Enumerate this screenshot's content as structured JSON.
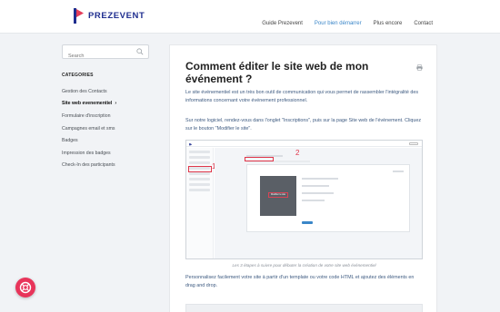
{
  "header": {
    "brand": "PREZEVENT",
    "nav": [
      {
        "label": "Guide Prezevent",
        "active": false
      },
      {
        "label": "Pour bien démarrer",
        "active": true
      },
      {
        "label": "Plus encore",
        "active": false
      },
      {
        "label": "Contact",
        "active": false
      }
    ]
  },
  "sidebar": {
    "search_placeholder": "Search",
    "categories_title": "CATEGORIES",
    "items": [
      {
        "label": "Gestion des Contacts"
      },
      {
        "label": "Site web evenementiel",
        "active": true
      },
      {
        "label": "Formulaire d'inscription"
      },
      {
        "label": "Campagnes email et sms"
      },
      {
        "label": "Badges"
      },
      {
        "label": "Impression des badges"
      },
      {
        "label": "Check-In des participants"
      }
    ]
  },
  "article": {
    "title": "Comment éditer le site web de mon événement ?",
    "paragraph1": "Le site événementiel est un très bon outil de communication qui vous permet de rassembler l'intégralité des informations concernant votre événement professionnel.",
    "paragraph2": "Sur notre logiciel, rendez-vous dans l'onglet \"Inscriptions\", puis sur la page Site web de l'évènement. Cliquez sur le bouton \"Modifier le site\".",
    "screenshot_marker_1": "1",
    "screenshot_marker_2": "2",
    "screenshot_button": "Modifier le site",
    "caption": "Les 3 étapes à suivre pour débuter la création de votre site web événementiel",
    "paragraph3": "Personnalisez facilement votre site à partir d'un template ou votre code HTML et ajoutez des éléments en drag and drop."
  },
  "colors": {
    "brand_navy": "#1f2e8f",
    "accent_pink": "#e8345a",
    "link_blue": "#3a86c8",
    "body_text_blue": "#3d5a80"
  },
  "icons": {
    "search": "search-icon",
    "print": "print-icon",
    "help": "lifebuoy-icon"
  }
}
